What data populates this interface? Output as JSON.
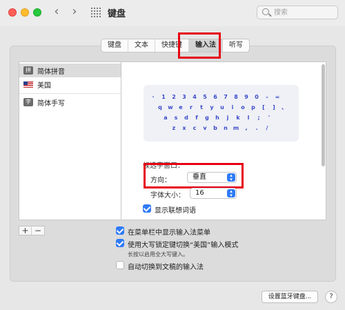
{
  "window": {
    "title": "键盘"
  },
  "search": {
    "placeholder": "搜索"
  },
  "tabs": [
    {
      "label": "键盘"
    },
    {
      "label": "文本"
    },
    {
      "label": "快捷键"
    },
    {
      "label": "输入法"
    },
    {
      "label": "听写"
    }
  ],
  "active_tab": "输入法",
  "sources": [
    {
      "label": "简体拼音",
      "icon": "pinyin-icon",
      "icon_glyph": "拼",
      "selected": true
    },
    {
      "label": "美国",
      "icon": "us-flag-icon",
      "selected": false
    },
    {
      "label": "简体手写",
      "icon": "handwriting-icon",
      "icon_glyph": "字",
      "selected": false
    }
  ],
  "keyboard": {
    "rows": [
      [
        "·",
        "1",
        "2",
        "3",
        "4",
        "5",
        "6",
        "7",
        "8",
        "9",
        "0",
        "-",
        "="
      ],
      [
        "q",
        "w",
        "e",
        "r",
        "t",
        "y",
        "u",
        "i",
        "o",
        "p",
        "[",
        "]",
        "、"
      ],
      [
        "a",
        "s",
        "d",
        "f",
        "g",
        "h",
        "j",
        "k",
        "l",
        ";",
        "'"
      ],
      [
        "z",
        "x",
        "c",
        "v",
        "b",
        "n",
        "m",
        ",",
        ".",
        "/"
      ]
    ]
  },
  "candidate_window": {
    "label": "候选字窗口：",
    "direction_label": "方向：",
    "direction_value": "垂直",
    "font_size_label": "字体大小：",
    "font_size_value": "16",
    "show_predictions_label": "显示联想词语",
    "show_predictions": true
  },
  "options": {
    "show_in_menubar": {
      "label": "在菜单栏中显示输入法菜单",
      "checked": true
    },
    "capslock_switch": {
      "label": "使用大写锁定键切换“美国”输入模式",
      "checked": true,
      "sublabel": "长按以启用全大写键入。"
    },
    "auto_switch": {
      "label": "自动切换到文稿的输入法",
      "checked": false
    }
  },
  "list_controls": {
    "add": "+",
    "remove": "−"
  },
  "footer": {
    "bluetooth_button": "设置蓝牙键盘...",
    "help": "?"
  },
  "colors": {
    "accent": "#2f7bf6",
    "highlight": "#e60012",
    "key_text": "#3a49c9"
  }
}
